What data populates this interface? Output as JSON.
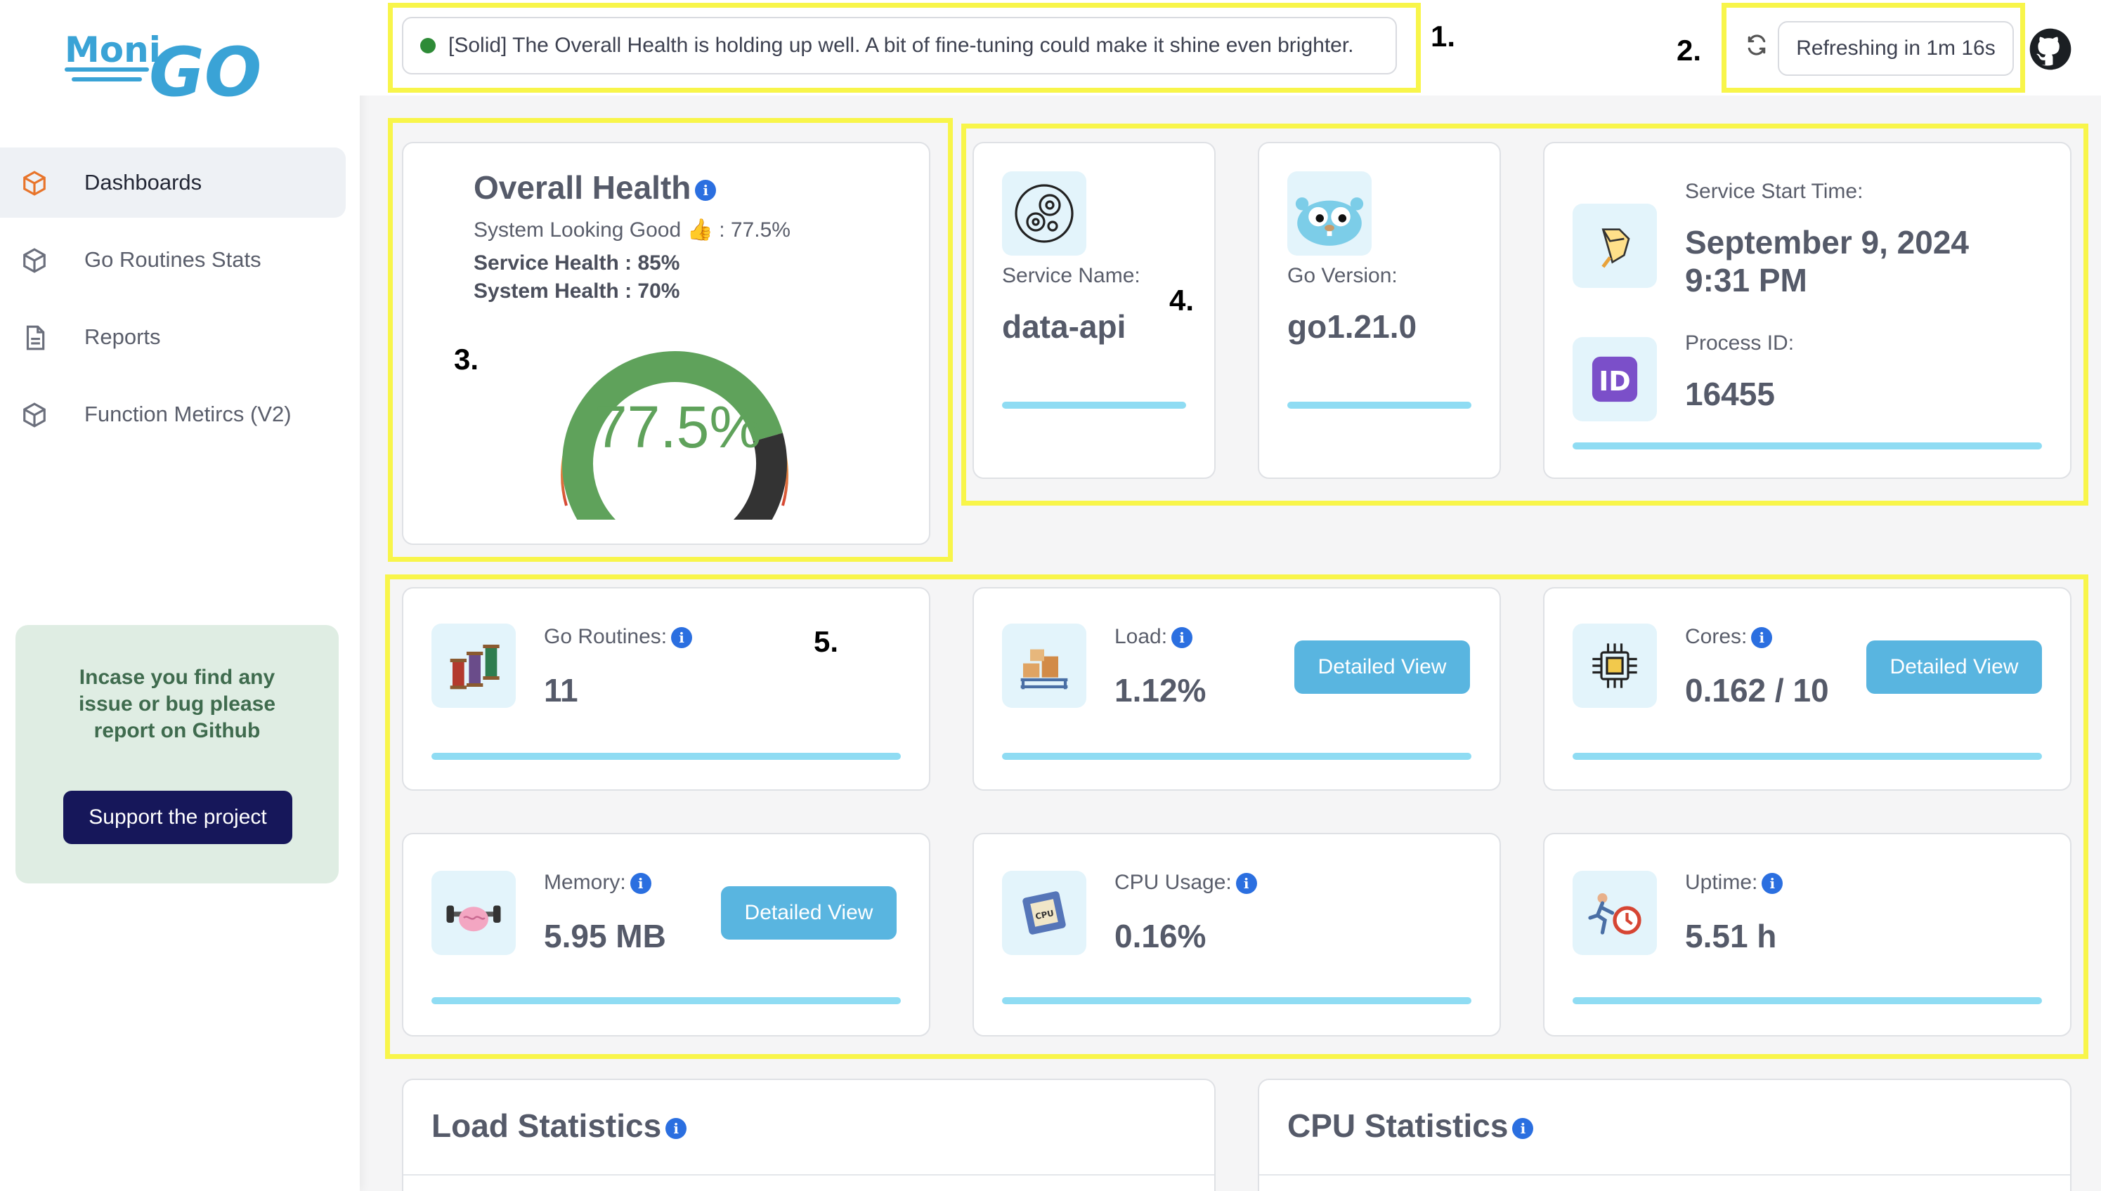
{
  "app": {
    "logo_text_top": "Moni",
    "logo_text_main": "GO"
  },
  "sidebar": {
    "items": [
      {
        "label": "Dashboards",
        "icon": "cube-icon",
        "active": true
      },
      {
        "label": "Go Routines Stats",
        "icon": "cube-icon",
        "active": false
      },
      {
        "label": "Reports",
        "icon": "document-icon",
        "active": false
      },
      {
        "label": "Function Metircs (V2)",
        "icon": "cube-icon",
        "active": false
      }
    ],
    "issue_text": "Incase you find any issue or bug please report on Github",
    "support_label": "Support the project"
  },
  "header": {
    "status_message": "[Solid] The Overall Health is holding up well. A bit of fine-tuning could make it shine even brighter.",
    "status_color": "#2e8b37",
    "refresh_label": "Refreshing in 1m 16s"
  },
  "annotations": [
    "1.",
    "2.",
    "3.",
    "4.",
    "5."
  ],
  "overall_health": {
    "title": "Overall Health",
    "status_line": "System Looking Good 👍 : 77.5%",
    "service_health": "Service Health : 85%",
    "system_health": "System Health : 70%",
    "gauge_label": "77.5%",
    "gauge_value": 0.775
  },
  "service_info": {
    "service_name_label": "Service Name:",
    "service_name": "data-api",
    "go_version_label": "Go Version:",
    "go_version": "go1.21.0",
    "start_time_label": "Service Start Time:",
    "start_date": "September 9, 2024",
    "start_time": "9:31 PM",
    "pid_label": "Process ID:",
    "pid": "16455"
  },
  "metrics": {
    "goroutines": {
      "label": "Go Routines:",
      "value": "11"
    },
    "load": {
      "label": "Load:",
      "value": "1.12%",
      "button": "Detailed View"
    },
    "cores": {
      "label": "Cores:",
      "value": "0.162 / 10",
      "button": "Detailed View"
    },
    "memory": {
      "label": "Memory:",
      "value": "5.95 MB",
      "button": "Detailed View"
    },
    "cpu": {
      "label": "CPU Usage:",
      "value": "0.16%"
    },
    "uptime": {
      "label": "Uptime:",
      "value": "5.51 h"
    }
  },
  "sections": {
    "load_stats": "Load Statistics",
    "cpu_stats": "CPU Statistics"
  },
  "colors": {
    "accent_bar": "#8fdcf3",
    "button": "#59b5e0",
    "support_button": "#16175a",
    "annotation": "#f8f54a",
    "gauge_green": "#5fa25b",
    "gauge_dark": "#333333"
  }
}
